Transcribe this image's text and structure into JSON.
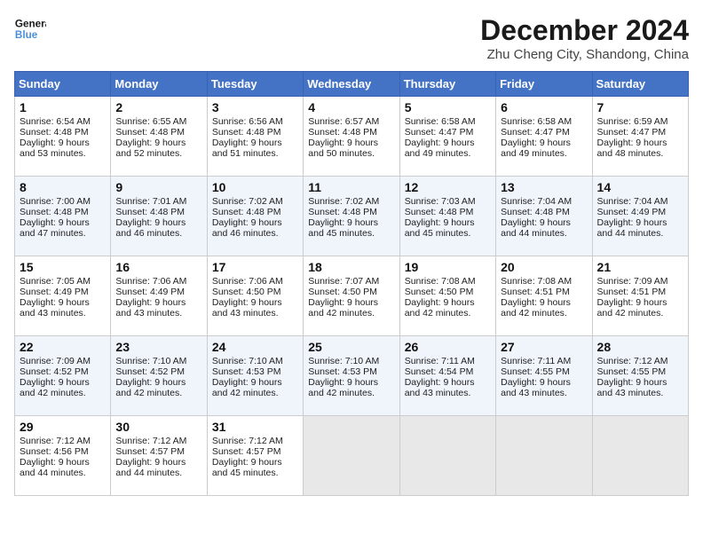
{
  "logo": {
    "line1": "General",
    "line2": "Blue"
  },
  "title": "December 2024",
  "subtitle": "Zhu Cheng City, Shandong, China",
  "days_of_week": [
    "Sunday",
    "Monday",
    "Tuesday",
    "Wednesday",
    "Thursday",
    "Friday",
    "Saturday"
  ],
  "weeks": [
    [
      {
        "day": 1,
        "sunrise": "6:54 AM",
        "sunset": "4:48 PM",
        "daylight": "9 hours and 53 minutes."
      },
      {
        "day": 2,
        "sunrise": "6:55 AM",
        "sunset": "4:48 PM",
        "daylight": "9 hours and 52 minutes."
      },
      {
        "day": 3,
        "sunrise": "6:56 AM",
        "sunset": "4:48 PM",
        "daylight": "9 hours and 51 minutes."
      },
      {
        "day": 4,
        "sunrise": "6:57 AM",
        "sunset": "4:48 PM",
        "daylight": "9 hours and 50 minutes."
      },
      {
        "day": 5,
        "sunrise": "6:58 AM",
        "sunset": "4:47 PM",
        "daylight": "9 hours and 49 minutes."
      },
      {
        "day": 6,
        "sunrise": "6:58 AM",
        "sunset": "4:47 PM",
        "daylight": "9 hours and 49 minutes."
      },
      {
        "day": 7,
        "sunrise": "6:59 AM",
        "sunset": "4:47 PM",
        "daylight": "9 hours and 48 minutes."
      }
    ],
    [
      {
        "day": 8,
        "sunrise": "7:00 AM",
        "sunset": "4:48 PM",
        "daylight": "9 hours and 47 minutes."
      },
      {
        "day": 9,
        "sunrise": "7:01 AM",
        "sunset": "4:48 PM",
        "daylight": "9 hours and 46 minutes."
      },
      {
        "day": 10,
        "sunrise": "7:02 AM",
        "sunset": "4:48 PM",
        "daylight": "9 hours and 46 minutes."
      },
      {
        "day": 11,
        "sunrise": "7:02 AM",
        "sunset": "4:48 PM",
        "daylight": "9 hours and 45 minutes."
      },
      {
        "day": 12,
        "sunrise": "7:03 AM",
        "sunset": "4:48 PM",
        "daylight": "9 hours and 45 minutes."
      },
      {
        "day": 13,
        "sunrise": "7:04 AM",
        "sunset": "4:48 PM",
        "daylight": "9 hours and 44 minutes."
      },
      {
        "day": 14,
        "sunrise": "7:04 AM",
        "sunset": "4:49 PM",
        "daylight": "9 hours and 44 minutes."
      }
    ],
    [
      {
        "day": 15,
        "sunrise": "7:05 AM",
        "sunset": "4:49 PM",
        "daylight": "9 hours and 43 minutes."
      },
      {
        "day": 16,
        "sunrise": "7:06 AM",
        "sunset": "4:49 PM",
        "daylight": "9 hours and 43 minutes."
      },
      {
        "day": 17,
        "sunrise": "7:06 AM",
        "sunset": "4:50 PM",
        "daylight": "9 hours and 43 minutes."
      },
      {
        "day": 18,
        "sunrise": "7:07 AM",
        "sunset": "4:50 PM",
        "daylight": "9 hours and 42 minutes."
      },
      {
        "day": 19,
        "sunrise": "7:08 AM",
        "sunset": "4:50 PM",
        "daylight": "9 hours and 42 minutes."
      },
      {
        "day": 20,
        "sunrise": "7:08 AM",
        "sunset": "4:51 PM",
        "daylight": "9 hours and 42 minutes."
      },
      {
        "day": 21,
        "sunrise": "7:09 AM",
        "sunset": "4:51 PM",
        "daylight": "9 hours and 42 minutes."
      }
    ],
    [
      {
        "day": 22,
        "sunrise": "7:09 AM",
        "sunset": "4:52 PM",
        "daylight": "9 hours and 42 minutes."
      },
      {
        "day": 23,
        "sunrise": "7:10 AM",
        "sunset": "4:52 PM",
        "daylight": "9 hours and 42 minutes."
      },
      {
        "day": 24,
        "sunrise": "7:10 AM",
        "sunset": "4:53 PM",
        "daylight": "9 hours and 42 minutes."
      },
      {
        "day": 25,
        "sunrise": "7:10 AM",
        "sunset": "4:53 PM",
        "daylight": "9 hours and 42 minutes."
      },
      {
        "day": 26,
        "sunrise": "7:11 AM",
        "sunset": "4:54 PM",
        "daylight": "9 hours and 43 minutes."
      },
      {
        "day": 27,
        "sunrise": "7:11 AM",
        "sunset": "4:55 PM",
        "daylight": "9 hours and 43 minutes."
      },
      {
        "day": 28,
        "sunrise": "7:12 AM",
        "sunset": "4:55 PM",
        "daylight": "9 hours and 43 minutes."
      }
    ],
    [
      {
        "day": 29,
        "sunrise": "7:12 AM",
        "sunset": "4:56 PM",
        "daylight": "9 hours and 44 minutes."
      },
      {
        "day": 30,
        "sunrise": "7:12 AM",
        "sunset": "4:57 PM",
        "daylight": "9 hours and 44 minutes."
      },
      {
        "day": 31,
        "sunrise": "7:12 AM",
        "sunset": "4:57 PM",
        "daylight": "9 hours and 45 minutes."
      },
      null,
      null,
      null,
      null
    ]
  ]
}
